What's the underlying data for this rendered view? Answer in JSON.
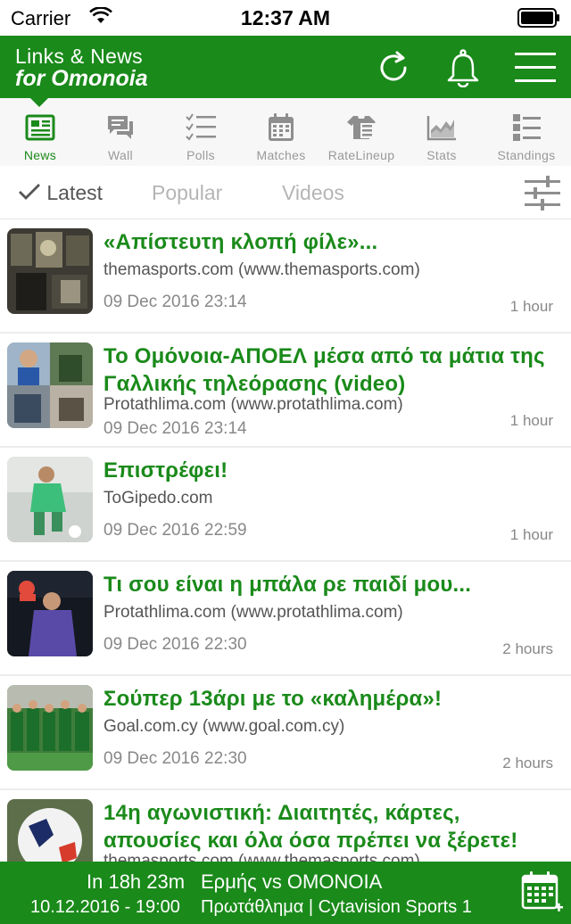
{
  "status_bar": {
    "carrier": "Carrier",
    "time": "12:37 AM"
  },
  "header": {
    "title_line1": "Links & News",
    "title_line2": "for Omonoia",
    "buttons": [
      "refresh-icon",
      "bell-icon",
      "menu-icon"
    ]
  },
  "colors": {
    "brand_green": "#1a8a1a",
    "inactive_gray": "#999999"
  },
  "tabs": [
    {
      "label": "News",
      "icon": "news-icon",
      "active": true
    },
    {
      "label": "Wall",
      "icon": "wall-chat-icon",
      "active": false
    },
    {
      "label": "Polls",
      "icon": "polls-list-icon",
      "active": false
    },
    {
      "label": "Matches",
      "icon": "calendar-icon",
      "active": false
    },
    {
      "label": "RateLineup",
      "icon": "jersey-icon",
      "active": false
    },
    {
      "label": "Stats",
      "icon": "stats-chart-icon",
      "active": false
    },
    {
      "label": "Standings",
      "icon": "standings-icon",
      "active": false
    }
  ],
  "filters": {
    "latest": "Latest",
    "popular": "Popular",
    "videos": "Videos",
    "selected": "Latest"
  },
  "news": [
    {
      "title": "«Απίστευτη κλοπή φίλε»...",
      "source": "themasports.com (www.themasports.com)",
      "date": "09 Dec 2016 23:14",
      "ago": "1 hour"
    },
    {
      "title": "Το Ομόνοια-ΑΠΟΕΛ μέσα από τα μάτια της Γαλλικής τηλεόρασης (video)",
      "source": "Protathlima.com (www.protathlima.com)",
      "date": "09 Dec 2016 23:14",
      "ago": "1 hour"
    },
    {
      "title": "Επιστρέφει!",
      "source": "ToGipedo.com",
      "date": "09 Dec 2016 22:59",
      "ago": "1 hour"
    },
    {
      "title": "Τι σου είναι η μπάλα ρε παιδί μου...",
      "source": "Protathlima.com (www.protathlima.com)",
      "date": "09 Dec 2016 22:30",
      "ago": "2 hours"
    },
    {
      "title": "Σούπερ 13άρι με το «καλημέρα»!",
      "source": "Goal.com.cy (www.goal.com.cy)",
      "date": "09 Dec 2016 22:30",
      "ago": "2 hours"
    },
    {
      "title": "14η αγωνιστική: Διαιτητές, κάρτες, απουσίες και όλα όσα πρέπει να ξέρετε!",
      "source": "themasports.com (www.themasports.com)",
      "date": "",
      "ago": ""
    }
  ],
  "next_match": {
    "countdown": "In 18h 23m",
    "teams": "Ερμής vs ΟΜΟΝΟΙΑ",
    "datetime": "10.12.2016 - 19:00",
    "competition": "Πρωτάθλημα | Cytavision Sports 1"
  }
}
